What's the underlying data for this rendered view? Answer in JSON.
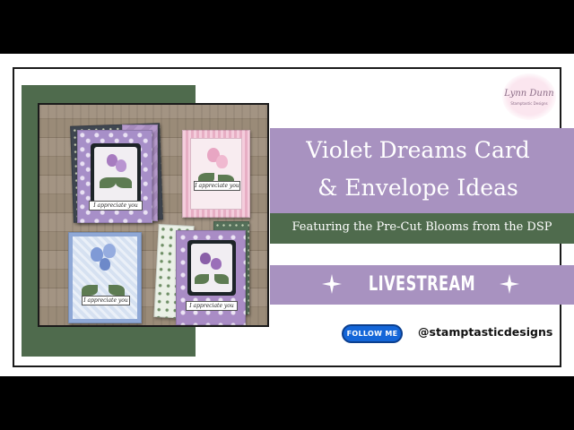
{
  "video": {
    "title_line1": "Violet Dreams Card",
    "title_line2": "& Envelope Ideas",
    "subtitle": "Featuring the Pre-Cut Blooms from the DSP",
    "live_label": "LIVESTREAM"
  },
  "brand": {
    "logo_name": "Lynn Dunn",
    "logo_tagline": "Stamptastic Designs",
    "follow_label": "FOLLOW ME",
    "handle": "@stamptasticdesigns"
  },
  "cards": {
    "sentiment": "I appreciate you"
  },
  "colors": {
    "violet": "#a892c0",
    "green": "#4f6b4d",
    "follow_blue": "#1466d8"
  }
}
